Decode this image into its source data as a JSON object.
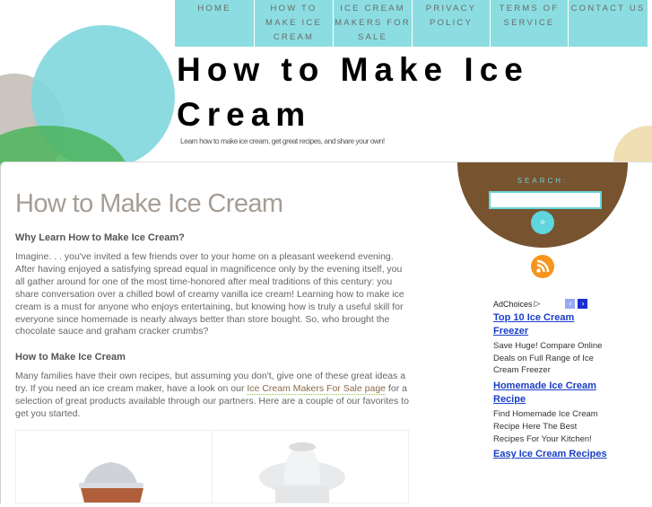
{
  "nav": {
    "items": [
      {
        "lines": [
          "HOME"
        ],
        "width": 88
      },
      {
        "lines": [
          "HOW TO",
          "MAKE ICE",
          "CREAM"
        ],
        "width": 87
      },
      {
        "lines": [
          "ICE CREAM",
          "MAKERS FOR",
          "SALE"
        ],
        "width": 87
      },
      {
        "lines": [
          "PRIVACY",
          "POLICY"
        ],
        "width": 86
      },
      {
        "lines": [
          "TERMS OF",
          "SERVICE"
        ],
        "width": 86
      },
      {
        "lines": [
          "CONTACT US"
        ],
        "width": 88
      }
    ]
  },
  "header": {
    "title": "How to Make Ice Cream",
    "tagline": "Learn how to make ice cream, get great recipes, and share your own!"
  },
  "main": {
    "page_title": "How to Make Ice Cream",
    "section1_heading": "Why Learn How to Make Ice Cream?",
    "section1_text": "Imagine. . . you've invited a few friends over to your home on a  pleasant weekend evening. After having enjoyed a satisfying spread equal in magnificence only by the evening itself, you all gather around for one of the most time-honored after meal traditions of this century: you share conversation over a chilled bowl of creamy vanilla ice cream! Learning how to make ice cream is a must for anyone who enjoys entertaining, but knowing how is truly a useful skill for everyone since homemade is nearly always better than store bought. So, who brought the chocolate sauce and graham cracker crumbs?",
    "section2_heading": "How to Make Ice Cream",
    "section2_text_before": "Many families have their own recipes, but assuming you don't, give one of these great ideas a try. If you need an ice cream maker, have a look on our ",
    "section2_link": "Ice Cream Makers For Sale page",
    "section2_text_after": " for a selection of great products available through our partners. Here are a couple of our favorites to get you started.",
    "products": [
      "ice-cream-maker-brown-bucket",
      "ice-cream-maker-white"
    ]
  },
  "sidebar": {
    "search_label": "SEARCH:",
    "search_value": "",
    "search_button": "»",
    "rss_icon": "rss-icon",
    "ads": {
      "adchoices_label": "AdChoices",
      "items": [
        {
          "title": "Top 10 Ice Cream Freezer",
          "desc": "Save Huge! Compare Online Deals on Full Range of Ice Cream Freezer"
        },
        {
          "title": "Homemade Ice Cream Recipe",
          "desc": "Find Homemade Ice Cream Recipe Here The Best Recipes For Your Kitchen!"
        },
        {
          "title": "Easy Ice Cream Recipes",
          "desc": ""
        }
      ]
    }
  },
  "colors": {
    "nav_bg": "#8cdde1",
    "search_bowl": "#77532f",
    "accent_teal": "#5fd6de",
    "rss": "#f7941d",
    "ad_link": "#1a3ec7",
    "page_title": "#a59d95"
  }
}
